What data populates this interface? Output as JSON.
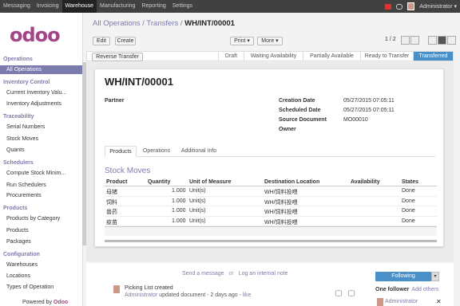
{
  "topbar": {
    "menu": [
      "Messaging",
      "Invoicing",
      "Warehouse",
      "Manufacturing",
      "Reporting",
      "Settings"
    ],
    "user": "Administrator"
  },
  "sidebar": {
    "logo": "odoo",
    "powered_by": "Powered by",
    "brand": "Odoo",
    "sections": [
      {
        "title": "Operations",
        "items": [
          "All Operations"
        ]
      },
      {
        "title": "Inventory Control",
        "items": [
          "Current Inventory Valu...",
          "Inventory Adjustments"
        ]
      },
      {
        "title": "Traceability",
        "items": [
          "Serial Numbers",
          "Stock Moves",
          "Quants"
        ]
      },
      {
        "title": "Schedulers",
        "items": [
          "Compute Stock Minim...",
          "Run Schedulers",
          "Procurements"
        ]
      },
      {
        "title": "Products",
        "items": [
          "Products by Category",
          "Products",
          "Packages"
        ]
      },
      {
        "title": "Configuration",
        "items": [
          "Warehouses",
          "Locations",
          "Types of Operation"
        ]
      }
    ]
  },
  "breadcrumb": {
    "part1": "All Operations",
    "part2": "Transfers",
    "current": "WH/INT/00001",
    "sep": " / "
  },
  "toolbar": {
    "edit": "Edit",
    "create": "Create",
    "print": "Print ▾",
    "more": "More ▾",
    "pager": "1 / 2",
    "reverse": "Reverse Transfer"
  },
  "stages": [
    "Draft",
    "Waiting Availability",
    "Partially Available",
    "Ready to Transfer",
    "Transferred"
  ],
  "form": {
    "title": "WH/INT/00001",
    "partner_label": "Partner",
    "creation_label": "Creation Date",
    "creation_value": "05/27/2015 07:05:11",
    "scheduled_label": "Scheduled Date",
    "scheduled_value": "05/27/2015 07:05:11",
    "source_label": "Source Document",
    "source_value": "MO00010",
    "owner_label": "Owner",
    "tabs": [
      "Products",
      "Operations",
      "Additional Info"
    ],
    "section_title": "Stock Moves",
    "columns": [
      "Product",
      "Quantity",
      "Unit of Measure",
      "Destination Location",
      "Availability",
      "States"
    ],
    "rows": [
      {
        "product": "母猪",
        "qty": "1.000",
        "uom": "Unit(s)",
        "dest": "WH/饲料投喂",
        "avail": "",
        "state": "Done"
      },
      {
        "product": "饲料",
        "qty": "1.000",
        "uom": "Unit(s)",
        "dest": "WH/饲料投喂",
        "avail": "",
        "state": "Done"
      },
      {
        "product": "兽药",
        "qty": "1.000",
        "uom": "Unit(s)",
        "dest": "WH/饲料投喂",
        "avail": "",
        "state": "Done"
      },
      {
        "product": "疫苗",
        "qty": "1.000",
        "uom": "Unit(s)",
        "dest": "WH/饲料投喂",
        "avail": "",
        "state": "Done"
      }
    ]
  },
  "chatter": {
    "send": "Send a message",
    "or": "or",
    "log": "Log an internal note",
    "following": "Following",
    "one_follower": "One follower",
    "add_others": "Add others",
    "msg_title": "Picking List created",
    "msg_author": "Administrator",
    "msg_text": "updated document - 2 days ago - ",
    "msg_like": "like",
    "follower_name": "Administrator"
  }
}
